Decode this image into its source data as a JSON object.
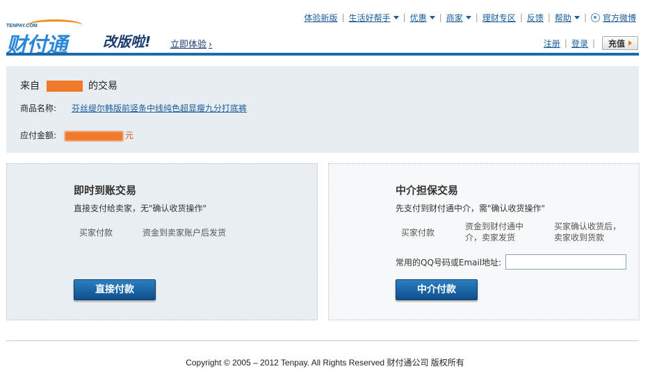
{
  "topnav": {
    "items": [
      {
        "label": "体验新版",
        "dropdown": false
      },
      {
        "label": "生活好帮手",
        "dropdown": true
      },
      {
        "label": "优惠",
        "dropdown": true
      },
      {
        "label": "商家",
        "dropdown": true
      },
      {
        "label": "理财专区",
        "dropdown": false
      },
      {
        "label": "反馈",
        "dropdown": false
      },
      {
        "label": "帮助",
        "dropdown": true
      }
    ],
    "weibo": "官方微博"
  },
  "brand": {
    "logo_small": "TENPAY.COM",
    "logo_text": "财付通",
    "slogan": "改版啦!",
    "try_now": "立即体验"
  },
  "account": {
    "register": "注册",
    "login": "登录",
    "recharge": "充值"
  },
  "order": {
    "from_prefix": "来自",
    "from_suffix": "的交易",
    "goods_label": "商品名称:",
    "goods_name": "芬丝缇尔韩版前竖条中线纯色超显瘦九分打底裤",
    "amount_label": "应付金额:",
    "amount_unit": "元"
  },
  "instant": {
    "title": "即时到账交易",
    "desc": "直接支付给卖家，无\"确认收货操作\"",
    "step1": "买家付款",
    "step2": "资金到卖家账户后发货",
    "button": "直接付款"
  },
  "escrow": {
    "title": "中介担保交易",
    "desc": "先支付到财付通中介，需\"确认收货操作\"",
    "step1": "买家付款",
    "step2": "资金到财付通中介，卖家发货",
    "step3": "买家确认收货后，卖家收到货款",
    "qq_label": "常用的QQ号码或Email地址:",
    "qq_value": "",
    "button": "中介付款"
  },
  "footer": {
    "copyright": "Copyright © 2005 – 2012 Tenpay. All Rights Reserved 财付通公司 版权所有"
  },
  "colors": {
    "accent_blue": "#1a6aaf",
    "redaction_orange": "#f07a2a",
    "button_blue": "#1a63a8"
  }
}
